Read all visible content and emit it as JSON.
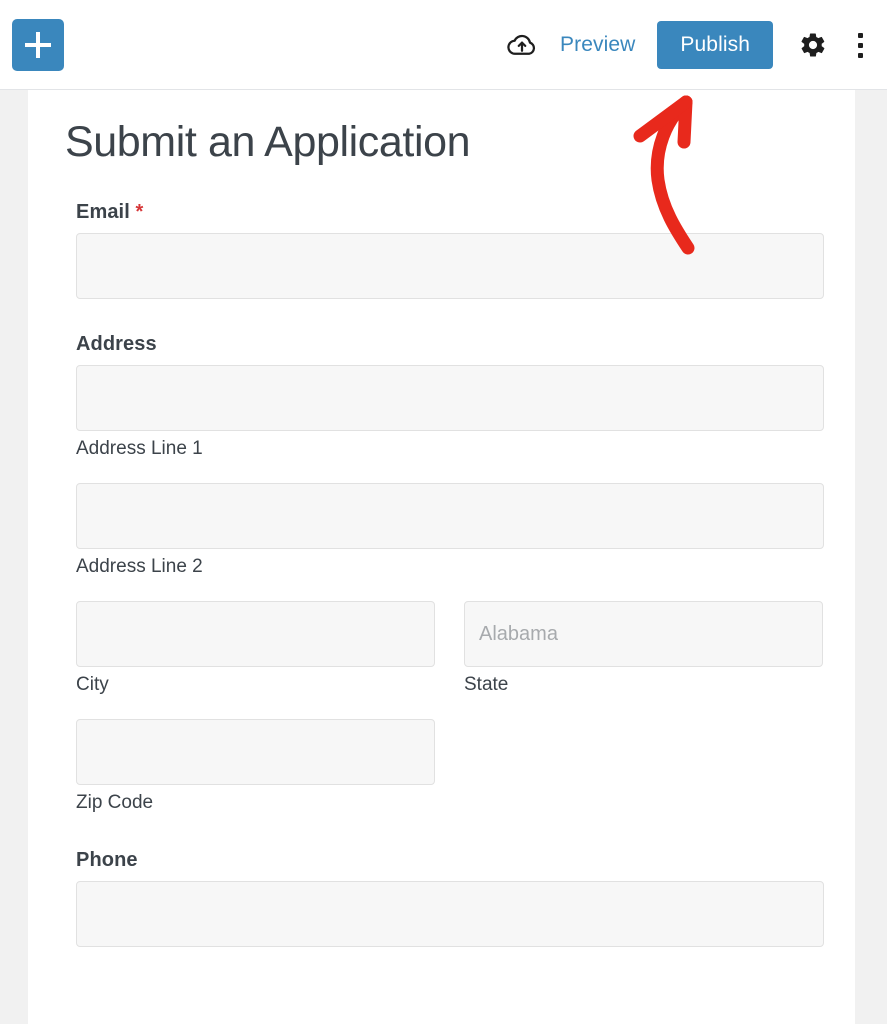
{
  "toolbar": {
    "add_block_label": "+",
    "add_block_name": "add-block",
    "cloud_save_icon": "cloud-upload-icon",
    "preview_label": "Preview",
    "publish_label": "Publish",
    "settings_icon": "gear-icon",
    "more_icon": "kebab-menu-icon",
    "publish_color": "#3a87bd",
    "link_color": "#3a87bd"
  },
  "annotation": {
    "type": "curved-arrow",
    "color": "#e8291c",
    "points_to": "publish-button"
  },
  "form": {
    "title": "Submit an Application",
    "fields": [
      {
        "name": "email",
        "label": "Email",
        "required": true,
        "required_mark": "*",
        "value": "",
        "placeholder": ""
      },
      {
        "name": "address",
        "label": "Address",
        "required": false,
        "subfields": [
          {
            "name": "address-line-1",
            "sublabel": "Address Line 1",
            "value": "",
            "placeholder": ""
          },
          {
            "name": "address-line-2",
            "sublabel": "Address Line 2",
            "value": "",
            "placeholder": ""
          },
          {
            "name": "city",
            "sublabel": "City",
            "value": "",
            "placeholder": ""
          },
          {
            "name": "state",
            "sublabel": "State",
            "value": "",
            "placeholder": "Alabama"
          },
          {
            "name": "zip-code",
            "sublabel": "Zip Code",
            "value": "",
            "placeholder": ""
          }
        ]
      },
      {
        "name": "phone",
        "label": "Phone",
        "required": false,
        "value": "",
        "placeholder": ""
      }
    ]
  },
  "colors": {
    "label_text": "#3c434a",
    "required_asterisk": "#d63638",
    "input_background": "#f7f7f7",
    "input_border": "#e1e1e1",
    "canvas_background": "#ffffff",
    "editor_background": "#f1f1f1"
  }
}
